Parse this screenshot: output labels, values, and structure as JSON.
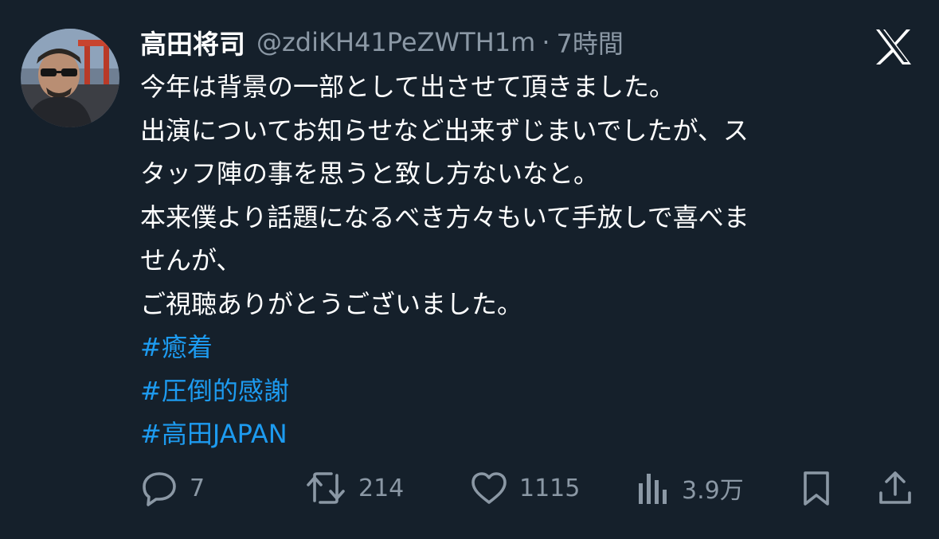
{
  "tweet": {
    "display_name": "高田将司",
    "handle": "@zdiKH41PeZWTH1m",
    "separator": "·",
    "timestamp": "7時間",
    "body_lines": [
      "今年は背景の一部として出させて頂きました。",
      "出演についてお知らせなど出来ずじまいでしたが、ス",
      "タッフ陣の事を思うと致し方ないなと。",
      "本来僕より話題になるべき方々もいて手放しで喜べま",
      "せんが、",
      "ご視聴ありがとうございました。"
    ],
    "hashtags": [
      "#癒着",
      "#圧倒的感謝",
      "#高田JAPAN"
    ]
  },
  "actions": {
    "reply_count": "7",
    "retweet_count": "214",
    "like_count": "1115",
    "views_count": "3.9万"
  },
  "icons": {
    "platform_logo": "x-logo-icon",
    "reply": "reply-icon",
    "retweet": "retweet-icon",
    "like": "heart-icon",
    "views": "views-icon",
    "bookmark": "bookmark-icon",
    "share": "share-icon"
  },
  "colors": {
    "background": "#15202b",
    "text": "#ffffff",
    "secondary_text": "#8b98a5",
    "hashtag": "#1d9bf0"
  }
}
